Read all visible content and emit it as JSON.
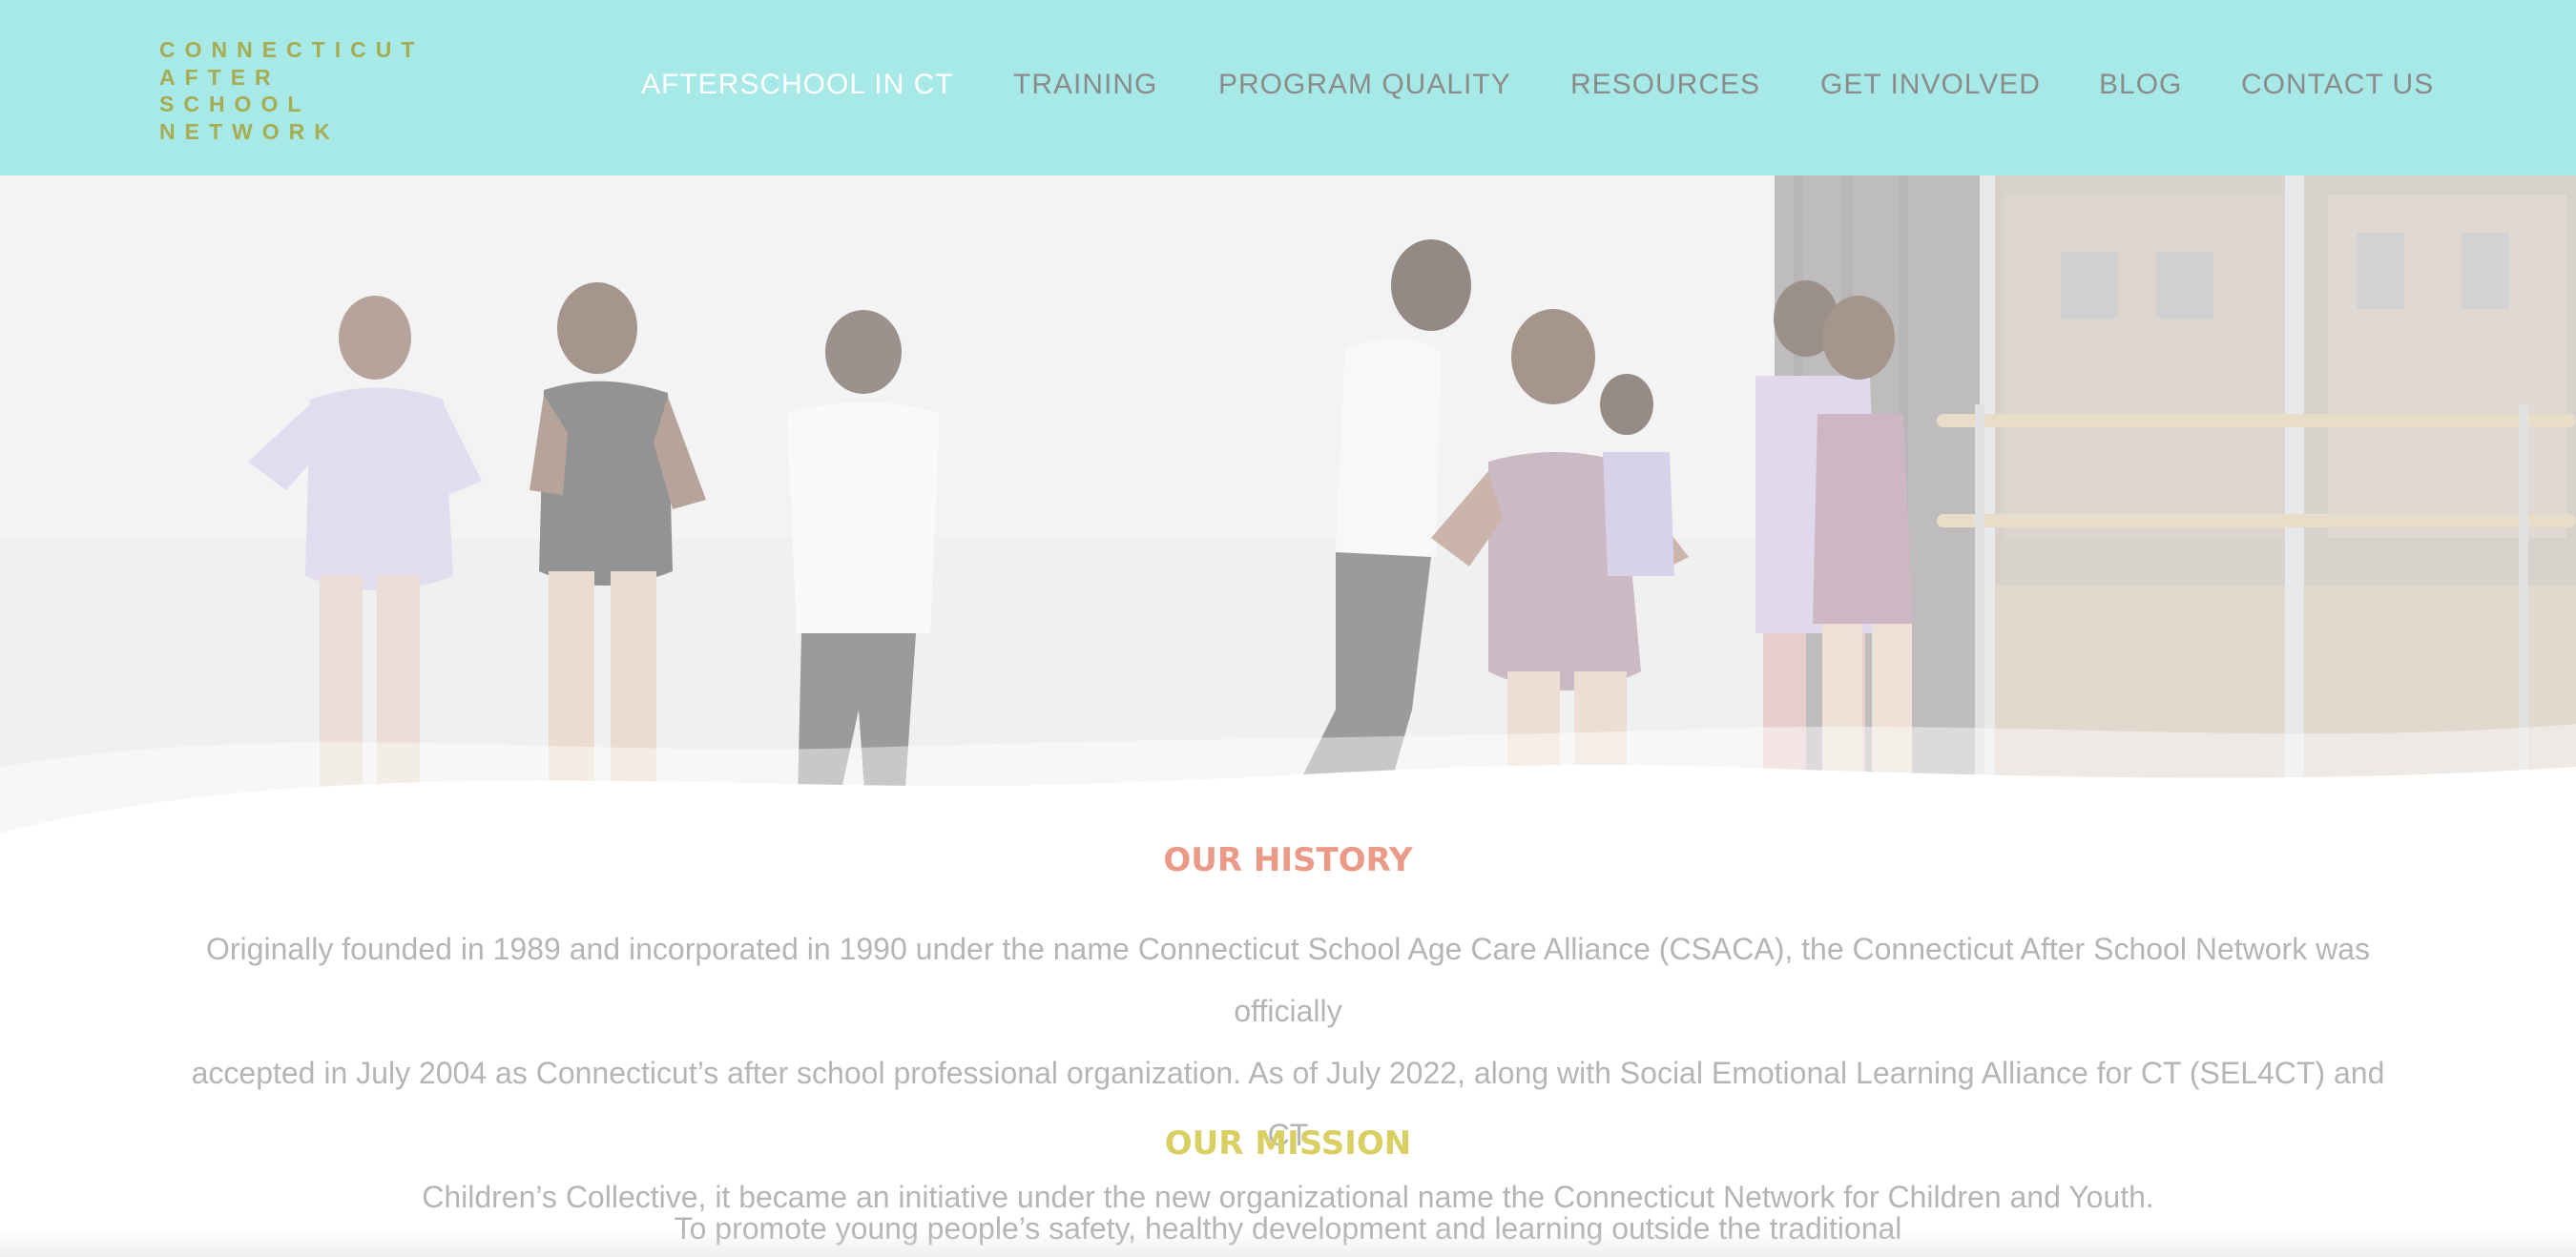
{
  "logo": {
    "lines": [
      "CONNECTICUT",
      "AFTER",
      "SCHOOL",
      "NETWORK"
    ]
  },
  "nav": {
    "items": [
      {
        "label": "AFTERSCHOOL IN CT",
        "active": true
      },
      {
        "label": "TRAINING",
        "active": false
      },
      {
        "label": "PROGRAM QUALITY",
        "active": false
      },
      {
        "label": "RESOURCES",
        "active": false
      },
      {
        "label": "GET INVOLVED",
        "active": false
      },
      {
        "label": "BLOG",
        "active": false
      },
      {
        "label": "CONTACT US",
        "active": false
      }
    ]
  },
  "history": {
    "heading": "OUR HISTORY",
    "lines": [
      "Originally founded in 1989 and incorporated in 1990 under the name Connecticut School Age Care Alliance (CSACA), the Connecticut After School Network was officially",
      "accepted in July 2004 as Connecticut’s after school professional organization. As of July 2022, along with Social Emotional Learning Alliance for CT (SEL4CT) and CT",
      "Children’s Collective, it became an initiative under the new organizational name the Connecticut Network for Children and Youth."
    ]
  },
  "mission": {
    "heading": "OUR MISSION",
    "lines": [
      "To promote young people’s safety, healthy development and learning outside the traditional"
    ]
  },
  "colors": {
    "header_bg": "#a6e9e6",
    "logo": "#a7ac52",
    "nav_text": "#8b8b8b",
    "nav_active": "#ffffff",
    "history_heading": "#eb9a87",
    "mission_heading": "#d9cf63",
    "body_text": "#b5b5b5"
  }
}
